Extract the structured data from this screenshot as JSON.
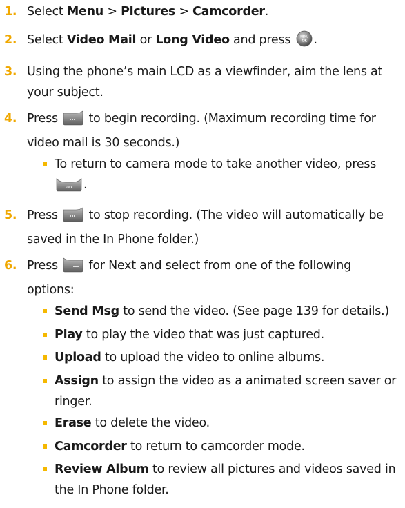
{
  "steps": [
    {
      "num": "1.",
      "a": "Select ",
      "b1": "Menu",
      "c": " > ",
      "b2": "Pictures",
      "d": " > ",
      "b3": "Camcorder",
      "e": "."
    },
    {
      "num": "2.",
      "a": "Select ",
      "b1": "Video Mail",
      "c": " or ",
      "b2": "Long Video",
      "d": " and press ",
      "e": "."
    },
    {
      "num": "3.",
      "text": "Using the phone’s main LCD as a viewfinder, aim the lens at your subject."
    },
    {
      "num": "4.",
      "a": "Press ",
      "b": " to begin recording. (Maximum recording time for video mail is 30 seconds.)"
    },
    {
      "num": "5.",
      "a": "Press ",
      "b": " to stop recording. (The video will automatically be saved in the In Phone folder.)"
    },
    {
      "num": "6.",
      "a": "Press ",
      "b": " for Next and select from one of the following options:"
    }
  ],
  "sub4": {
    "a": "To return to camera mode to take another video, press ",
    "b": "."
  },
  "options": [
    {
      "label": "Send Msg",
      "desc": " to send the video. (See page 139 for details.)"
    },
    {
      "label": "Play",
      "desc": " to play the video that was just captured."
    },
    {
      "label": "Upload",
      "desc": " to upload the video to online albums."
    },
    {
      "label": "Assign",
      "desc": " to assign the video as a animated screen saver or ringer."
    },
    {
      "label": "Erase",
      "desc": " to delete the video."
    },
    {
      "label": "Camcorder",
      "desc": " to return to camcorder mode."
    },
    {
      "label": "Review Album",
      "desc": " to review all pictures and videos saved in the In Phone folder."
    }
  ],
  "icons": {
    "menu_ok": {
      "name": "menu-ok-key-icon",
      "text_top": "MENU",
      "text_bottom": "OK"
    },
    "back": {
      "name": "back-key-icon",
      "text": "BACK"
    },
    "left_softkey": {
      "name": "left-softkey-icon"
    },
    "right_softkey": {
      "name": "right-softkey-icon"
    }
  },
  "colors": {
    "step_number": "#f0a800",
    "bullet": "#f5b800",
    "text": "#1a1a1a"
  }
}
